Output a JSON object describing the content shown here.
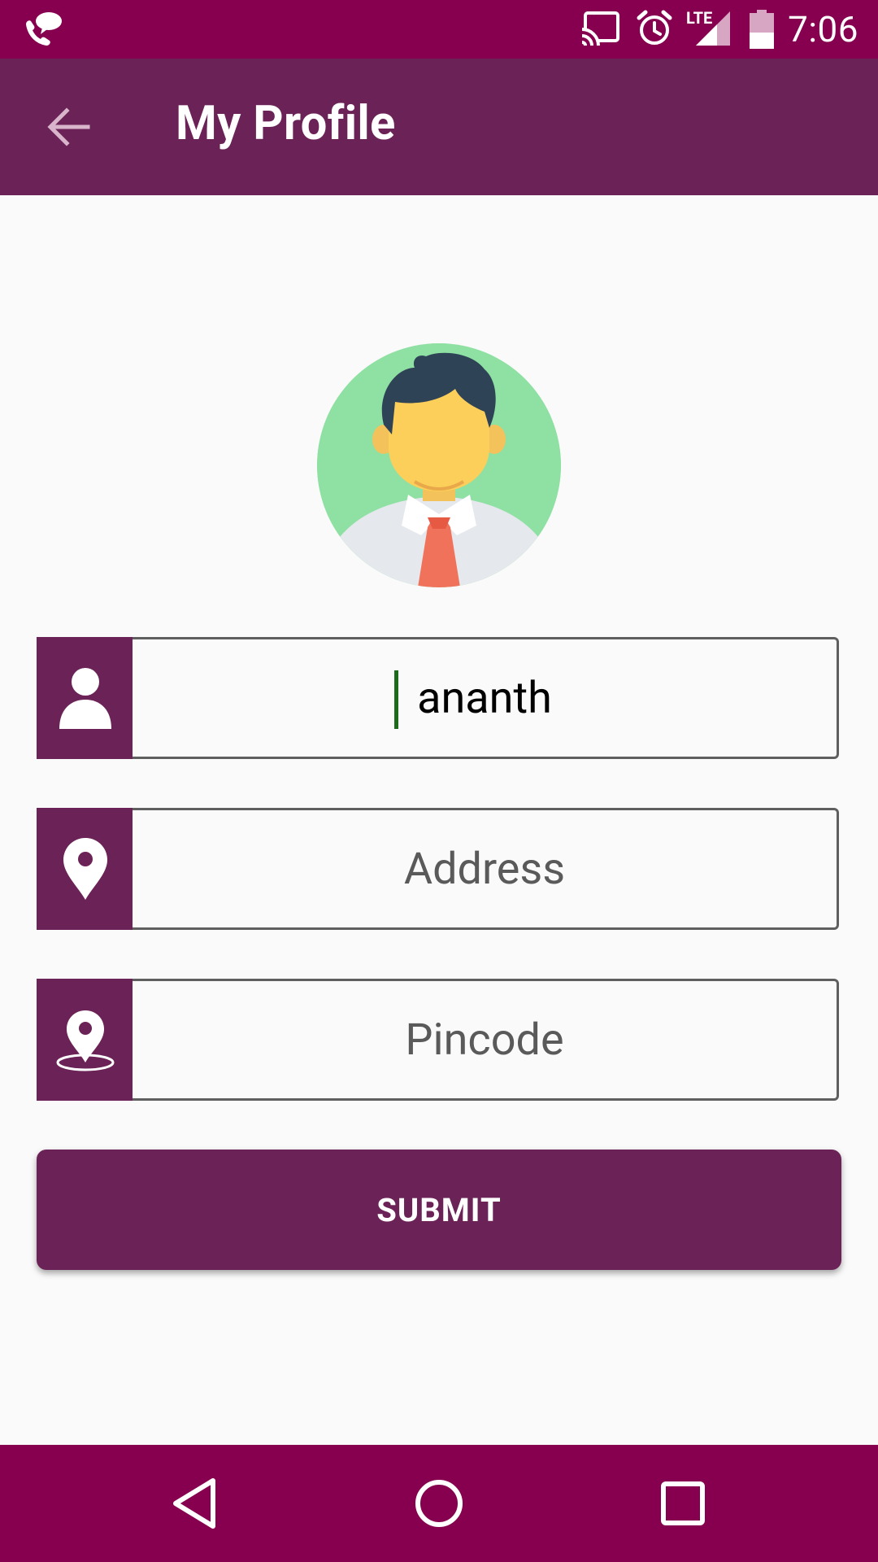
{
  "status_bar": {
    "time": "7:06",
    "network_label": "LTE",
    "icons": [
      "phone-chat-icon",
      "cast-icon",
      "alarm-icon",
      "signal-icon",
      "battery-icon"
    ]
  },
  "app_bar": {
    "title": "My Profile",
    "back_icon": "arrow-back-icon"
  },
  "form": {
    "name": {
      "value": "ananth",
      "placeholder": "",
      "icon": "person-icon"
    },
    "address": {
      "value": "",
      "placeholder": "Address",
      "icon": "location-pin-icon"
    },
    "pincode": {
      "value": "",
      "placeholder": "Pincode",
      "icon": "location-pin-area-icon"
    },
    "submit_label": "SUBMIT"
  },
  "colors": {
    "status_bar": "#870050",
    "primary": "#6b2357",
    "background": "#fafafa",
    "field_border": "#5f5f5f",
    "cursor": "#1b6b1b"
  },
  "nav_bar": {
    "icons": [
      "back-triangle-icon",
      "home-circle-icon",
      "recents-square-icon"
    ]
  }
}
